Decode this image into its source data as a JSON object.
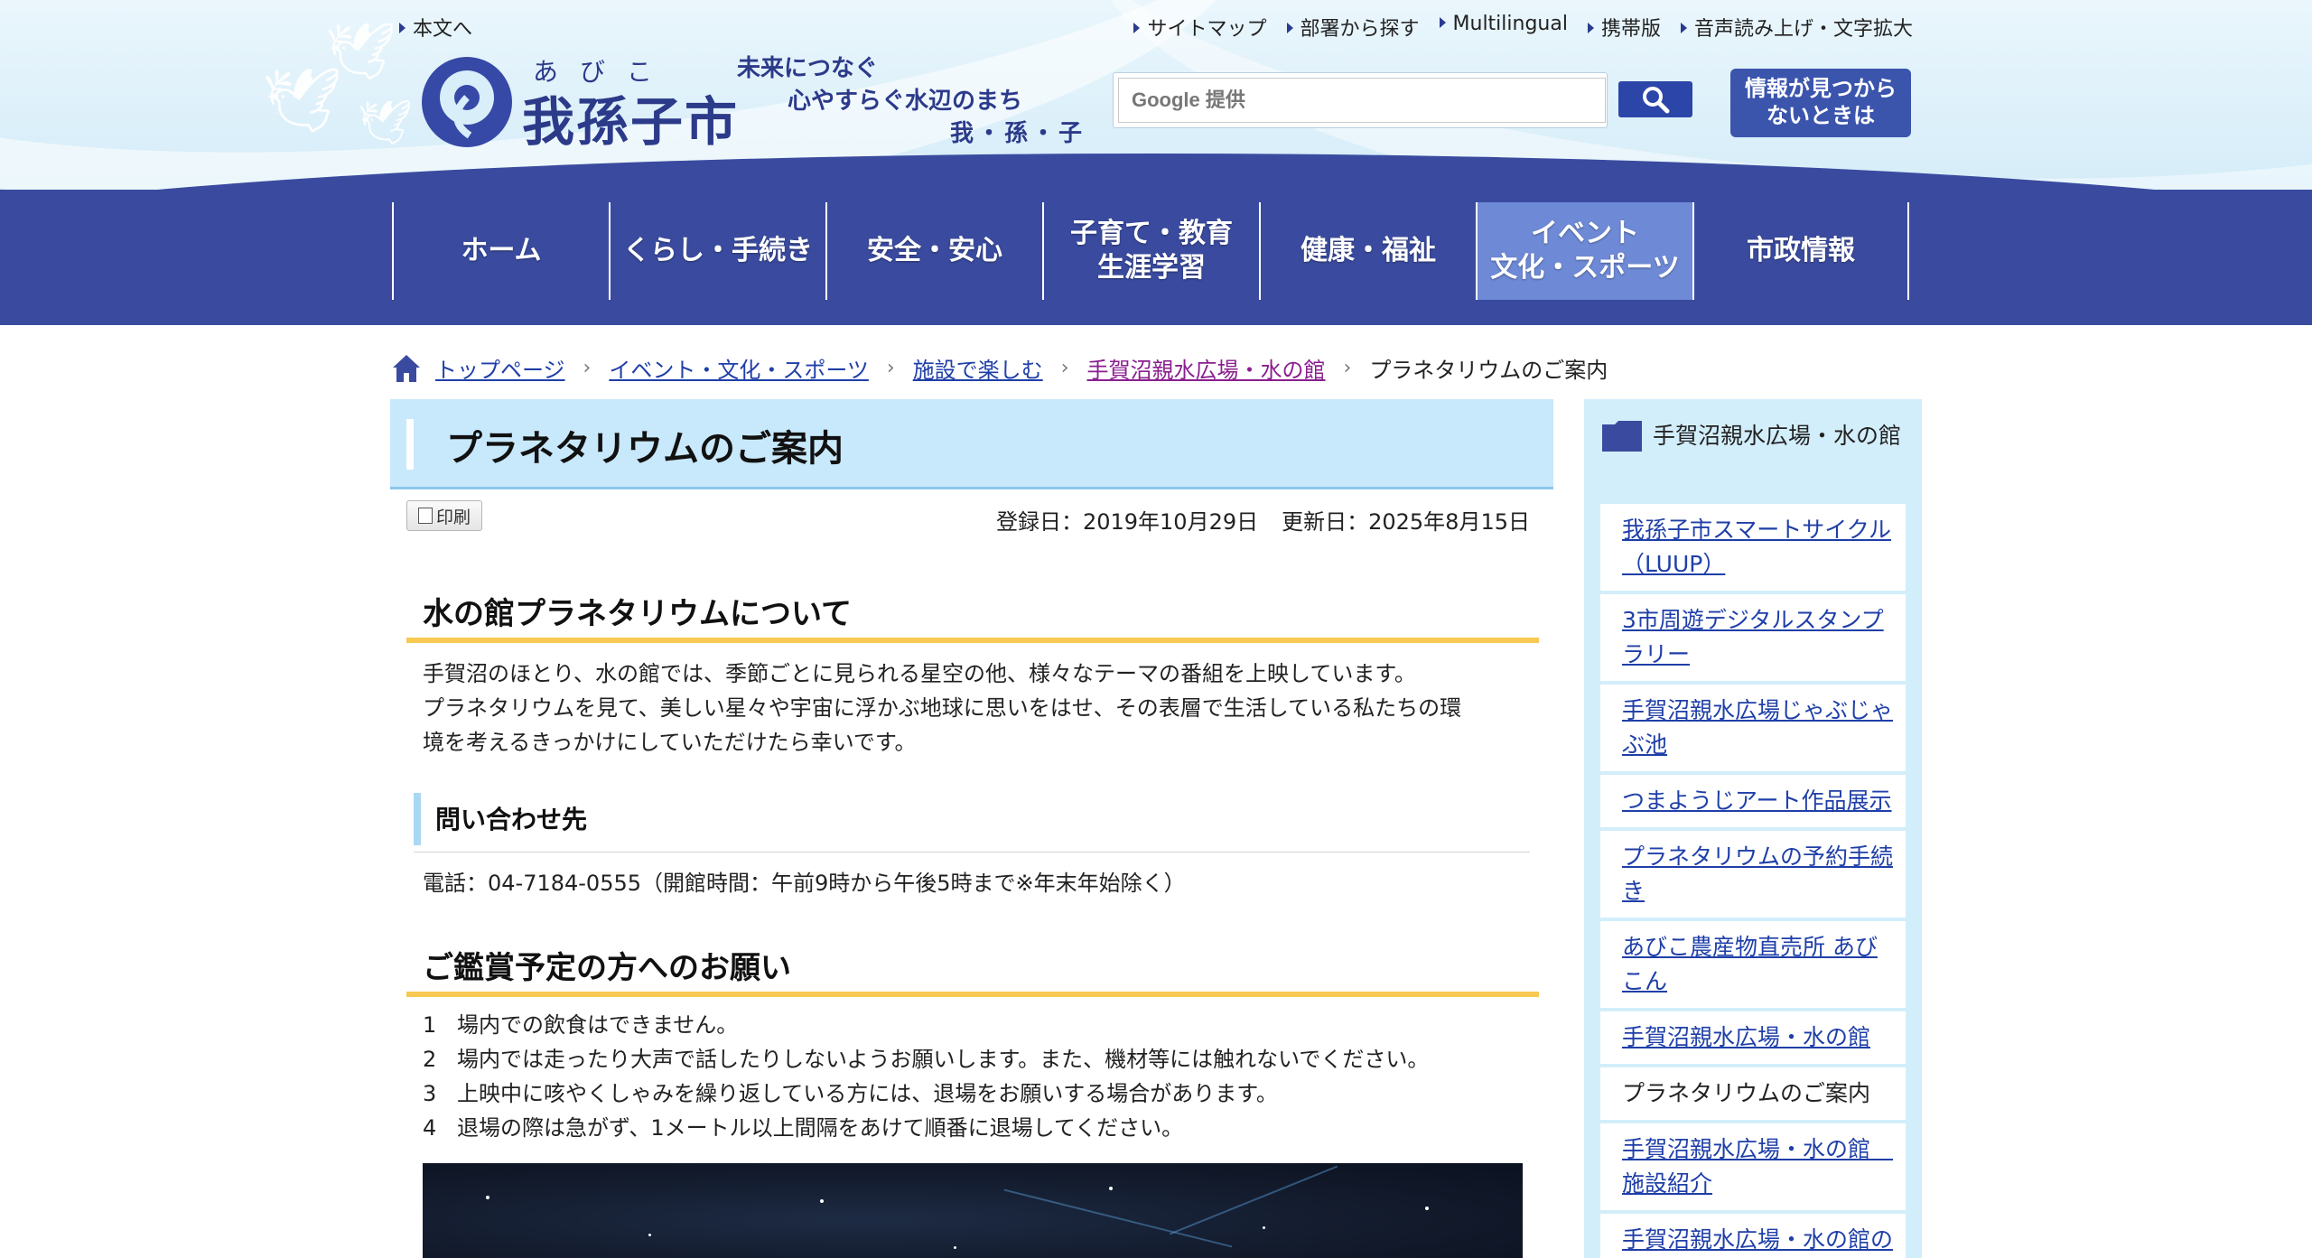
{
  "header": {
    "skip_link": "本文へ",
    "util_links": [
      "サイトマップ",
      "部署から探す",
      "Multilingual",
      "携帯版",
      "音声読み上げ・文字拡大"
    ],
    "logo_ruby": "あびこ",
    "logo_name": "我孫子市",
    "tagline": [
      "未来につなぐ",
      "心やすらぐ水辺のまち",
      "我・孫・子"
    ],
    "search": {
      "placeholder": "Google 提供"
    },
    "help_button": "情報が見つから\nないときは"
  },
  "nav": {
    "items": [
      {
        "label": "ホーム",
        "active": false
      },
      {
        "label": "くらし・手続き",
        "active": false
      },
      {
        "label": "安全・安心",
        "active": false
      },
      {
        "label": "子育て・教育\n生涯学習",
        "active": false
      },
      {
        "label": "健康・福祉",
        "active": false
      },
      {
        "label": "イベント\n文化・スポーツ",
        "active": true
      },
      {
        "label": "市政情報",
        "active": false
      }
    ]
  },
  "breadcrumb": {
    "items": [
      "トップページ",
      "イベント・文化・スポーツ",
      "施設で楽しむ",
      "手賀沼親水広場・水の館"
    ],
    "current": "プラネタリウムのご案内"
  },
  "main": {
    "title": "プラネタリウムのご案内",
    "print_label": "印刷",
    "registered": "登録日：2019年10月29日",
    "updated": "更新日：2025年8月15日",
    "section1": {
      "heading": "水の館プラネタリウムについて",
      "body": [
        "手賀沼のほとり、水の館では、季節ごとに見られる星空の他、様々なテーマの番組を上映しています。",
        "プラネタリウムを見て、美しい星々や宇宙に浮かぶ地球に思いをはせ、その表層で生活している私たちの環",
        "境を考えるきっかけにしていただけたら幸いです。"
      ]
    },
    "contact": {
      "heading": "問い合わせ先",
      "body": "電話：04-7184-0555（開館時間：午前9時から午後5時まで※年末年始除く）"
    },
    "section2": {
      "heading": "ご鑑賞予定の方へのお願い",
      "items": [
        {
          "num": "1",
          "text": "場内での飲食はできません。"
        },
        {
          "num": "2",
          "text": "場内では走ったり大声で話したりしないようお願いします。また、機材等には触れないでください。"
        },
        {
          "num": "3",
          "text": "上映中に咳やくしゃみを繰り返している方には、退場をお願いする場合があります。"
        },
        {
          "num": "4",
          "text": "退場の際は急がず、1メートル以上間隔をあけて順番に退場してください。"
        }
      ]
    }
  },
  "sidebar": {
    "heading": "手賀沼親水広場・水の館",
    "items": [
      {
        "label": "我孫子市スマートサイクル（LUUP）",
        "current": false
      },
      {
        "label": "3市周遊デジタルスタンプラリー",
        "current": false
      },
      {
        "label": "手賀沼親水広場じゃぶじゃぶ池",
        "current": false
      },
      {
        "label": "つまようじアート作品展示",
        "current": false
      },
      {
        "label": "プラネタリウムの予約手続き",
        "current": false
      },
      {
        "label": "あびこ農産物直売所 あびこん",
        "current": false
      },
      {
        "label": "手賀沼親水広場・水の館",
        "current": false
      },
      {
        "label": "プラネタリウムのご案内",
        "current": true
      },
      {
        "label": "手賀沼親水広場・水の館　施設紹介",
        "current": false
      },
      {
        "label": "手賀沼親水広場・水の館の施設の使用",
        "current": false
      }
    ]
  },
  "colors": {
    "nav_band": "#3a4b9f",
    "nav_active": "#6e8ad6",
    "title_bg": "#c8e8fb",
    "heading_underline": "#f7c852",
    "sidebar_bg": "#d3eefb",
    "link": "#1f3fa8"
  }
}
